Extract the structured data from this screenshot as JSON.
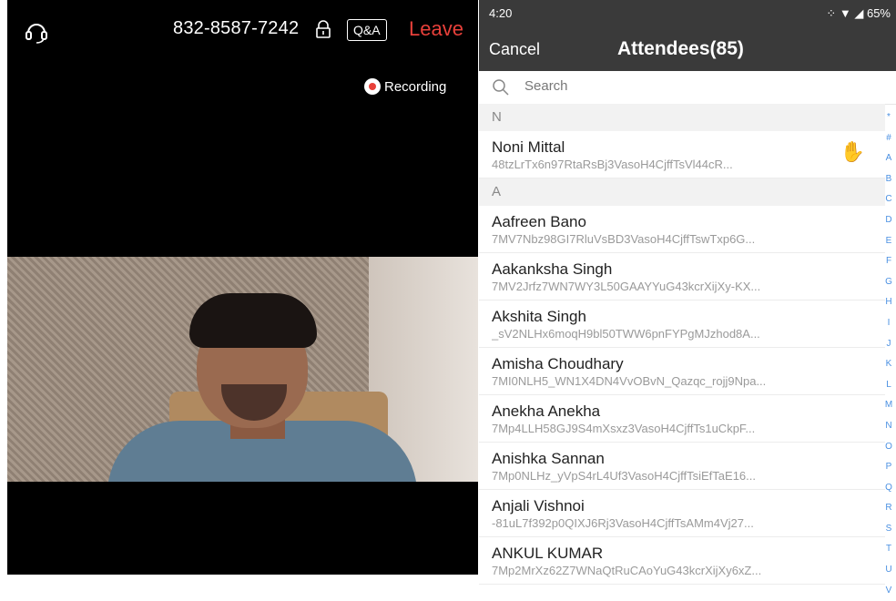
{
  "video_call": {
    "meeting_id": "832-8587-7242",
    "qa_label": "Q&A",
    "leave_label": "Leave",
    "recording_label": "Recording",
    "icons": [
      "headset-icon",
      "lock-icon",
      "record-icon"
    ]
  },
  "phone": {
    "status": {
      "time": "4:20",
      "right": "⁘ ▼ ◢ 65%"
    },
    "nav": {
      "cancel_label": "Cancel",
      "title": "Attendees(85)"
    },
    "search_placeholder": "Search",
    "sections": [
      {
        "letter": "N",
        "items": [
          {
            "name": "Noni Mittal",
            "sub": "48tzLrTx6n97RtaRsBj3VasoH4CjffTsVl44cR...",
            "hand_raised": true
          }
        ]
      },
      {
        "letter": "A",
        "items": [
          {
            "name": "Aafreen Bano",
            "sub": "7MV7Nbz98GI7RluVsBD3VasoH4CjffTswTxp6G..."
          },
          {
            "name": "Aakanksha Singh",
            "sub": "7MV2Jrfz7WN7WY3L50GAAYYuG43kcrXijXy-KX..."
          },
          {
            "name": "Akshita Singh",
            "sub": "_sV2NLHx6moqH9bl50TWW6pnFYPgMJzhod8A..."
          },
          {
            "name": "Amisha Choudhary",
            "sub": "7MI0NLH5_WN1X4DN4VvOBvN_Qazqc_rojj9Npa..."
          },
          {
            "name": "Anekha Anekha",
            "sub": "7Mp4LLH58GJ9S4mXsxz3VasoH4CjffTs1uCkpF..."
          },
          {
            "name": "Anishka Sannan",
            "sub": "7Mp0NLHz_yVpS4rL4Uf3VasoH4CjffTsiEfTaE16..."
          },
          {
            "name": "Anjali Vishnoi",
            "sub": "-81uL7f392p0QIXJ6Rj3VasoH4CjffTsAMm4Vj27..."
          },
          {
            "name": "ANKUL KUMAR",
            "sub": "7Mp2MrXz62Z7WNaQtRuCAoYuG43kcrXijXy6xZ..."
          }
        ]
      }
    ],
    "index_letters": [
      "*",
      "#",
      "A",
      "B",
      "C",
      "D",
      "E",
      "F",
      "G",
      "H",
      "I",
      "J",
      "K",
      "L",
      "M",
      "N",
      "O",
      "P",
      "Q",
      "R",
      "S",
      "T",
      "U",
      "V"
    ]
  }
}
